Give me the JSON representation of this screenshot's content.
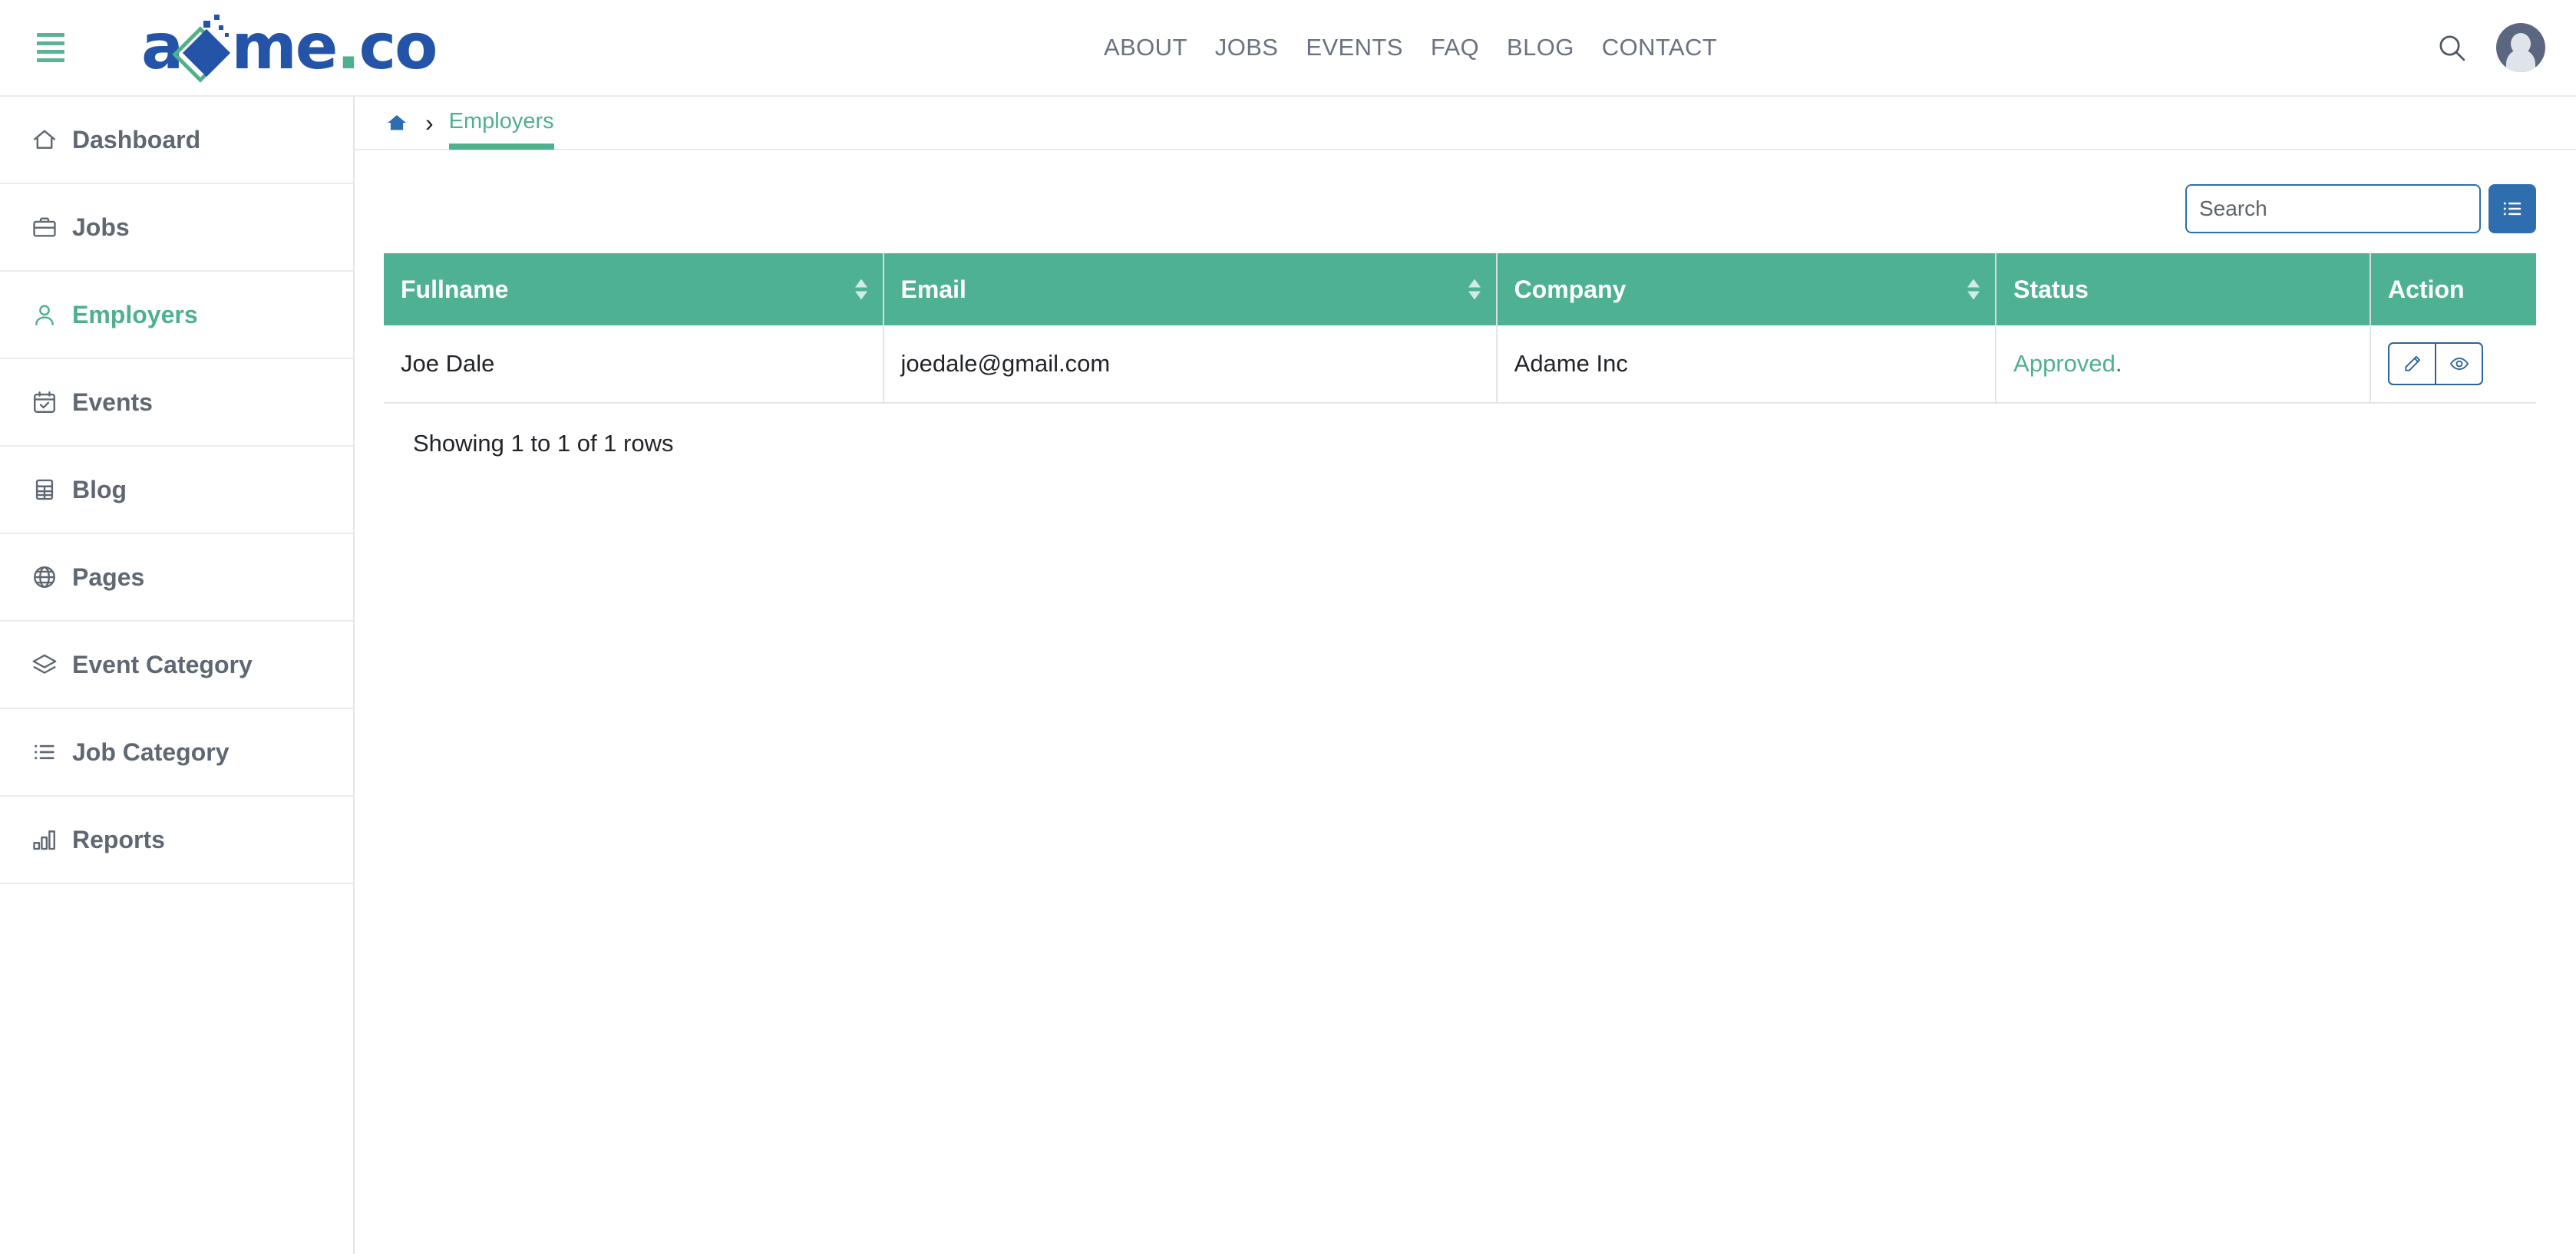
{
  "header": {
    "menu_toggle": "hamburger-menu",
    "logo": {
      "text_before": "a",
      "text_after": "me",
      "dot": ".",
      "text_end": "co"
    },
    "nav": [
      {
        "label": "ABOUT"
      },
      {
        "label": "JOBS"
      },
      {
        "label": "EVENTS"
      },
      {
        "label": "FAQ"
      },
      {
        "label": "BLOG"
      },
      {
        "label": "CONTACT"
      }
    ],
    "search_icon": "search-icon",
    "avatar": "user-avatar"
  },
  "sidebar": {
    "items": [
      {
        "label": "Dashboard",
        "icon": "home-icon",
        "active": false
      },
      {
        "label": "Jobs",
        "icon": "briefcase-icon",
        "active": false
      },
      {
        "label": "Employers",
        "icon": "user-icon",
        "active": true
      },
      {
        "label": "Events",
        "icon": "calendar-icon",
        "active": false
      },
      {
        "label": "Blog",
        "icon": "table-icon",
        "active": false
      },
      {
        "label": "Pages",
        "icon": "globe-icon",
        "active": false
      },
      {
        "label": "Event Category",
        "icon": "layers-icon",
        "active": false
      },
      {
        "label": "Job Category",
        "icon": "list-ul-icon",
        "active": false
      },
      {
        "label": "Reports",
        "icon": "bar-chart-icon",
        "active": false
      }
    ]
  },
  "breadcrumb": {
    "home_icon": "home-icon",
    "separator": "›",
    "current": "Employers"
  },
  "toolbar": {
    "search_placeholder": "Search",
    "search_value": "",
    "list_button_icon": "list-view-icon"
  },
  "table": {
    "columns": [
      {
        "label": "Fullname",
        "sortable": true
      },
      {
        "label": "Email",
        "sortable": true
      },
      {
        "label": "Company",
        "sortable": true
      },
      {
        "label": "Status",
        "sortable": false
      },
      {
        "label": "Action",
        "sortable": false
      }
    ],
    "rows": [
      {
        "fullname": "Joe Dale",
        "email": "joedale@gmail.com",
        "company": "Adame Inc",
        "status": "Approved",
        "status_suffix": ".",
        "actions": [
          "edit-icon",
          "view-icon"
        ]
      }
    ],
    "footer": "Showing 1 to 1 of 1 rows"
  },
  "colors": {
    "brand_green": "#4fb08c",
    "table_header_green": "#4fb194",
    "logo_blue": "#2454a8",
    "button_blue": "#2f6eae",
    "action_border_blue": "#2d6397",
    "nav_gray": "#6b7280",
    "sidebar_label_gray": "#5f6872"
  }
}
